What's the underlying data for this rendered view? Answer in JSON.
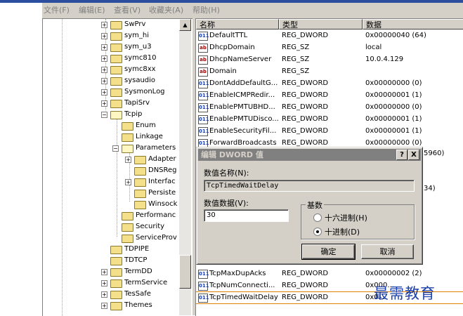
{
  "menu": [
    "文件(F)",
    "编辑(E)",
    "查看(V)",
    "收藏夹(A)",
    "帮助(H)"
  ],
  "tree": {
    "items": [
      {
        "label": "SwPrv"
      },
      {
        "label": "sym_hi"
      },
      {
        "label": "sym_u3"
      },
      {
        "label": "symc810"
      },
      {
        "label": "symc8xx"
      },
      {
        "label": "sysaudio"
      },
      {
        "label": "SysmonLog"
      },
      {
        "label": "TapiSrv"
      },
      {
        "label": "Tcpip"
      },
      {
        "label": "Enum"
      },
      {
        "label": "Linkage"
      },
      {
        "label": "Parameters"
      },
      {
        "label": "Adapter"
      },
      {
        "label": "DNSReg"
      },
      {
        "label": "Interfac"
      },
      {
        "label": "Persiste"
      },
      {
        "label": "Winsock"
      },
      {
        "label": "Performanc"
      },
      {
        "label": "Security"
      },
      {
        "label": "ServiceProv"
      },
      {
        "label": "TDPIPE"
      },
      {
        "label": "TDTCP"
      },
      {
        "label": "TermDD"
      },
      {
        "label": "TermService"
      },
      {
        "label": "TesSafe"
      },
      {
        "label": "Themes"
      }
    ]
  },
  "list": {
    "headers": [
      "名称",
      "类型",
      "数据"
    ],
    "rows": [
      {
        "icon": "dword",
        "name": "DefaultTTL",
        "type": "REG_DWORD",
        "data": "0x00000040 (64)"
      },
      {
        "icon": "sz",
        "name": "DhcpDomain",
        "type": "REG_SZ",
        "data": "local"
      },
      {
        "icon": "dword",
        "name": "DhcpNameServer",
        "type": "REG_SZ",
        "data": "10.0.4.129"
      },
      {
        "icon": "sz",
        "name": "Domain",
        "type": "REG_SZ",
        "data": ""
      },
      {
        "icon": "dword",
        "name": "DontAddDefaultG...",
        "type": "REG_DWORD",
        "data": "0x00000000 (0)"
      },
      {
        "icon": "dword",
        "name": "EnableICMPRedir...",
        "type": "REG_DWORD",
        "data": "0x00000001 (1)"
      },
      {
        "icon": "dword",
        "name": "EnablePMTUBHD...",
        "type": "REG_DWORD",
        "data": "0x00000000 (0)"
      },
      {
        "icon": "dword",
        "name": "EnablePMTUDisco...",
        "type": "REG_DWORD",
        "data": "0x00000001 (1)"
      },
      {
        "icon": "dword",
        "name": "EnableSecurityFil...",
        "type": "REG_DWORD",
        "data": "0x00000001 (1)"
      },
      {
        "icon": "dword",
        "name": "ForwardBroadcasts",
        "type": "REG_DWORD",
        "data": "0x00000000 (0)"
      }
    ],
    "bottom_rows": [
      {
        "icon": "dword",
        "name": "TcpMaxDupAcks",
        "type": "REG_DWORD",
        "data": "0x00000002 (2)"
      },
      {
        "icon": "dword",
        "name": "TcpNumConnecti...",
        "type": "REG_DWORD",
        "data": "0x000..."
      },
      {
        "icon": "dword",
        "name": "TcpTimedWaitDelay",
        "type": "REG_DWORD",
        "data": "0x0..."
      }
    ],
    "partial_right_1": "5960)",
    "partial_right_2": "34)"
  },
  "dialog": {
    "title": "编辑 DWORD 值",
    "help_btn": "?",
    "close_btn": "X",
    "name_label": "数值名称(N):",
    "name_value": "TcpTimedWaitDelay",
    "data_label": "数值数据(V):",
    "data_value": "30",
    "base_label": "基数",
    "hex_label": "十六进制(H)",
    "dec_label": "十进制(D)",
    "base_selected": "dec",
    "ok": "确定",
    "cancel": "取消"
  },
  "watermark": "最需教育",
  "colors": {
    "dialog_title_bg": "#808080",
    "selected_outline": "#e08000",
    "watermark": "#1a3faa"
  }
}
